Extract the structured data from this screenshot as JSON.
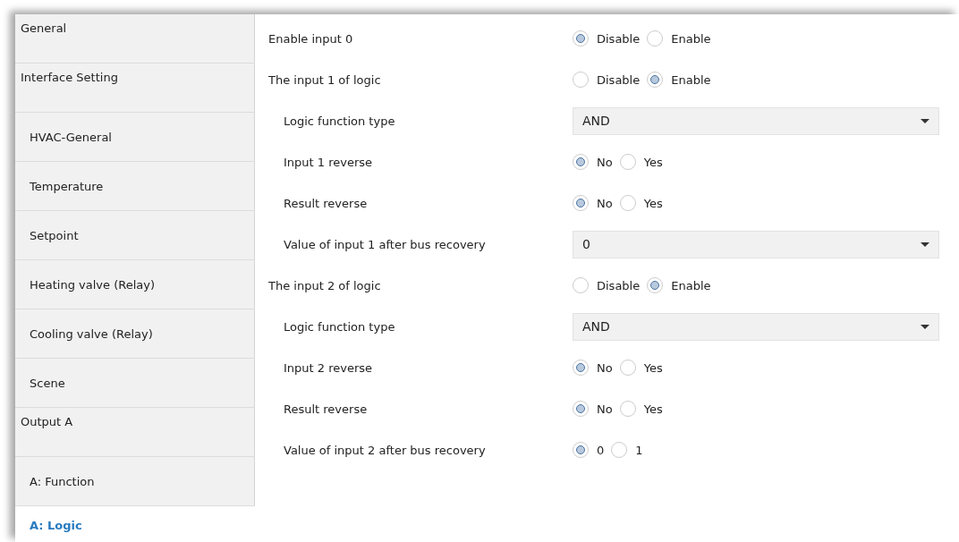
{
  "sidebar": {
    "items": [
      {
        "label": "General",
        "selected": false
      },
      {
        "label": "Interface Setting",
        "selected": false,
        "children": [
          {
            "label": "HVAC-General",
            "selected": false
          },
          {
            "label": "Temperature",
            "selected": false
          },
          {
            "label": "Setpoint",
            "selected": false
          },
          {
            "label": "Heating valve (Relay)",
            "selected": false
          },
          {
            "label": "Cooling valve (Relay)",
            "selected": false
          },
          {
            "label": "Scene",
            "selected": false
          }
        ]
      },
      {
        "label": "Output A",
        "selected": false,
        "children": [
          {
            "label": "A: Function",
            "selected": false
          },
          {
            "label": "A: Logic",
            "selected": true
          }
        ]
      }
    ]
  },
  "parameters": [
    {
      "label": "Enable input 0",
      "kind": "radio",
      "options": [
        {
          "label": "Disable",
          "selected": true
        },
        {
          "label": "Enable",
          "selected": false
        }
      ]
    },
    {
      "label": "The input 1 of logic",
      "kind": "radio",
      "options": [
        {
          "label": "Disable",
          "selected": false
        },
        {
          "label": "Enable",
          "selected": true
        }
      ],
      "children": [
        {
          "label": "Logic function type",
          "kind": "dropdown",
          "value": "AND"
        },
        {
          "label": "Input 1 reverse",
          "kind": "radio",
          "options": [
            {
              "label": "No",
              "selected": true
            },
            {
              "label": "Yes",
              "selected": false
            }
          ]
        },
        {
          "label": "Result reverse",
          "kind": "radio",
          "options": [
            {
              "label": "No",
              "selected": true
            },
            {
              "label": "Yes",
              "selected": false
            }
          ]
        },
        {
          "label": "Value of input 1 after bus recovery",
          "kind": "dropdown",
          "value": "0"
        }
      ]
    },
    {
      "label": "The input 2 of logic",
      "kind": "radio",
      "options": [
        {
          "label": "Disable",
          "selected": false
        },
        {
          "label": "Enable",
          "selected": true
        }
      ],
      "children": [
        {
          "label": "Logic function type",
          "kind": "dropdown",
          "value": "AND"
        },
        {
          "label": "Input 2 reverse",
          "kind": "radio",
          "options": [
            {
              "label": "No",
              "selected": true
            },
            {
              "label": "Yes",
              "selected": false
            }
          ]
        },
        {
          "label": "Result reverse",
          "kind": "radio",
          "options": [
            {
              "label": "No",
              "selected": true
            },
            {
              "label": "Yes",
              "selected": false
            }
          ]
        },
        {
          "label": "Value of input 2 after bus recovery",
          "kind": "radio",
          "options": [
            {
              "label": "0",
              "selected": true
            },
            {
              "label": "1",
              "selected": false
            }
          ]
        }
      ]
    }
  ]
}
